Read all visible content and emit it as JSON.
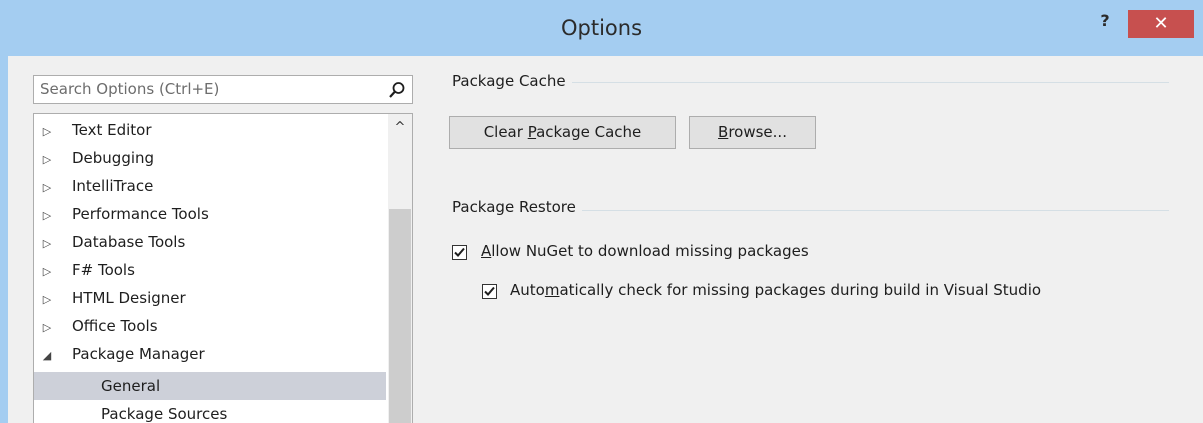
{
  "window": {
    "title": "Options",
    "help_label": "?",
    "close_label": "✕"
  },
  "search": {
    "placeholder": "Search Options (Ctrl+E)"
  },
  "tree": {
    "items": [
      {
        "label": "Text Editor",
        "expander": "▷"
      },
      {
        "label": "Debugging",
        "expander": "▷"
      },
      {
        "label": "IntelliTrace",
        "expander": "▷"
      },
      {
        "label": "Performance Tools",
        "expander": "▷"
      },
      {
        "label": "Database Tools",
        "expander": "▷"
      },
      {
        "label": "F# Tools",
        "expander": "▷"
      },
      {
        "label": "HTML Designer",
        "expander": "▷"
      },
      {
        "label": "Office Tools",
        "expander": "▷"
      },
      {
        "label": "Package Manager",
        "expander": "◢"
      }
    ],
    "children": [
      {
        "label": "General",
        "selected": true
      },
      {
        "label": "Package Sources",
        "selected": false
      }
    ],
    "scroll_up": "^"
  },
  "package_cache": {
    "heading": "Package Cache",
    "clear_button_pre": "Clear ",
    "clear_button_mnemonic": "P",
    "clear_button_post": "ackage Cache",
    "browse_button_mnemonic": "B",
    "browse_button_post": "rowse..."
  },
  "package_restore": {
    "heading": "Package Restore",
    "allow": {
      "mnemonic": "A",
      "rest": "llow NuGet to download missing packages",
      "checked": true
    },
    "auto": {
      "pre": "Auto",
      "mnemonic": "m",
      "rest": "atically check for missing packages during build in Visual Studio",
      "checked": true
    }
  },
  "icons": {
    "search": "search-icon",
    "checkbox": "check-icon"
  }
}
